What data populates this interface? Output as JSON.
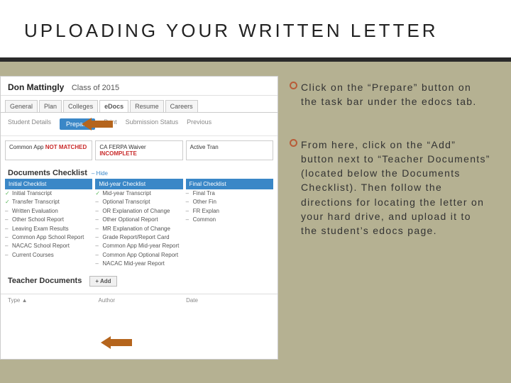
{
  "header": {
    "title": "UPLOADING YOUR WRITTEN LETTER"
  },
  "screenshot": {
    "student_name": "Don Mattingly",
    "class_label": "Class of 2015",
    "tabs": [
      "General",
      "Plan",
      "Colleges",
      "eDocs",
      "Resume",
      "Careers"
    ],
    "subtabs": {
      "first": "Student Details",
      "active": "Prepare",
      "rest": [
        "Print",
        "Submission Status",
        "Previous"
      ]
    },
    "status": {
      "a_pre": "Common App ",
      "a_red": "NOT MATCHED",
      "b_pre": "CA FERPA Waiver ",
      "b_red": "INCOMPLETE",
      "c": "Active Tran"
    },
    "docs_title": "Documents Checklist",
    "hide": "– Hide",
    "cols": {
      "initial": {
        "head": "Initial Checklist",
        "items": [
          {
            "t": "Initial Transcript",
            "c": "green"
          },
          {
            "t": "Transfer Transcript",
            "c": "green"
          },
          {
            "t": "Written Evaluation",
            "c": "dash"
          },
          {
            "t": "Other School Report",
            "c": "dash"
          },
          {
            "t": "Leaving Exam Results",
            "c": "dash"
          },
          {
            "t": "Common App School Report",
            "c": "dash"
          },
          {
            "t": "NACAC School Report",
            "c": "dash"
          },
          {
            "t": "Current Courses",
            "c": "dash"
          }
        ]
      },
      "mid": {
        "head": "Mid-year Checklist",
        "items": [
          {
            "t": "Mid-year Transcript",
            "c": "green"
          },
          {
            "t": "Optional Transcript",
            "c": "dash"
          },
          {
            "t": "OR Explanation of Change",
            "c": "dash"
          },
          {
            "t": "Other Optional Report",
            "c": "dash"
          },
          {
            "t": "MR Explanation of Change",
            "c": "dash"
          },
          {
            "t": "Grade Report/Report Card",
            "c": "dash"
          },
          {
            "t": "Common App Mid-year Report",
            "c": "dash"
          },
          {
            "t": "Common App Optional Report",
            "c": "dash"
          },
          {
            "t": "NACAC Mid-year Report",
            "c": "dash"
          }
        ]
      },
      "final": {
        "head": "Final Checklist",
        "items": [
          {
            "t": "Final Tra",
            "c": "dash"
          },
          {
            "t": "Other Fin",
            "c": "dash"
          },
          {
            "t": "FR Explan",
            "c": "dash"
          },
          {
            "t": "Common",
            "c": "dash"
          }
        ]
      }
    },
    "teacher_title": "Teacher Documents",
    "add_label": "+ Add",
    "table": {
      "type": "Type ▲",
      "author": "Author",
      "date": "Date"
    }
  },
  "instructions": {
    "p1": "Click on the “Prepare” button on the task bar under the edocs tab.",
    "p2": "From here, click on the “Add” button next to “Teacher Documents” (located below the Documents Checklist). Then follow the directions for locating the letter on your hard drive, and upload it to the student’s edocs page."
  }
}
